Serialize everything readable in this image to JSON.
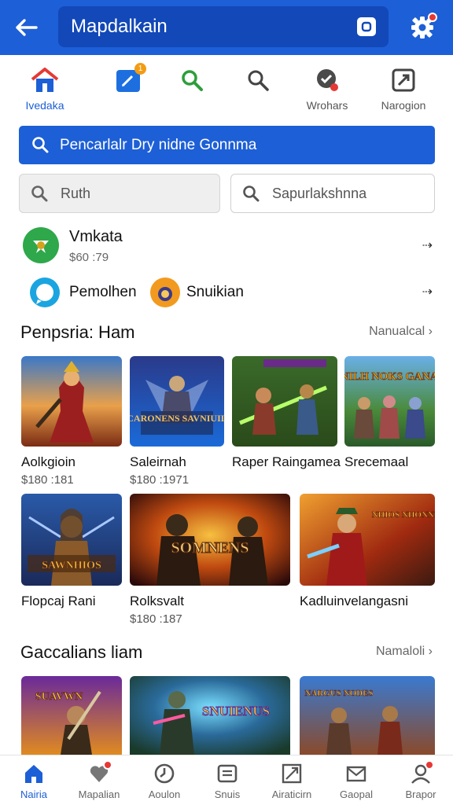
{
  "appbar": {
    "title": "Mapdalkain"
  },
  "categories": [
    {
      "label": "Ivedaka",
      "icon": "home-icon",
      "active": true
    },
    {
      "label": "",
      "icon": "edit-icon",
      "badge": "1"
    },
    {
      "label": "",
      "icon": "search-green-icon"
    },
    {
      "label": "",
      "icon": "search-icon"
    },
    {
      "label": "Wrohars",
      "icon": "award-icon"
    },
    {
      "label": "Narogion",
      "icon": "navigation-icon"
    }
  ],
  "search": {
    "main_placeholder": "Pencarlalr Dry nidne Gonnma",
    "left_placeholder": "Ruth",
    "right_placeholder": "Sapurlakshnna"
  },
  "list": [
    {
      "title": "Vmkata",
      "subtitle": "$60 :79",
      "icon": "green-badge-icon"
    },
    {
      "title": "Pemolhen",
      "icon": "chat-bubble-icon"
    },
    {
      "title": "Snuikian",
      "icon": "orange-avatar-icon"
    }
  ],
  "section1": {
    "title": "Penpsria: Ham",
    "link": "Nanualcal"
  },
  "row1": [
    {
      "name": "Aolkgioin",
      "price": "$180 :181",
      "caption": ""
    },
    {
      "name": "Saleirnah",
      "price": "$180 :1971",
      "caption": "CARONENS SAVNIUIL"
    },
    {
      "name": "Raper Raingamea",
      "price": "",
      "caption": ""
    },
    {
      "name": "Srecemaal",
      "price": "",
      "caption": "SNILH NOKS GANAS"
    }
  ],
  "row2": [
    {
      "name": "Flopcaj Rani",
      "price": "",
      "caption": "SAWNHIOS"
    },
    {
      "name": "Rolksvalt",
      "price": "$180 :187",
      "caption": "SOMNENS"
    },
    {
      "name": "Kadluinvelangasni",
      "price": "",
      "caption": "NHIOS NHONNES"
    }
  ],
  "section2": {
    "title": "Gaccalians liam",
    "link": "Namaloli"
  },
  "row3": [
    {
      "caption": "SUAVWN"
    },
    {
      "caption": "SNUIENUS"
    },
    {
      "caption": "NARGUS NODES"
    }
  ],
  "bottom_nav": [
    {
      "label": "Nairia",
      "icon": "home-icon",
      "active": true
    },
    {
      "label": "Mapalian",
      "icon": "heart-icon",
      "badge": true
    },
    {
      "label": "Aoulon",
      "icon": "clock-icon"
    },
    {
      "label": "Snuis",
      "icon": "box-icon"
    },
    {
      "label": "Airaticirn",
      "icon": "frame-icon"
    },
    {
      "label": "Gaopal",
      "icon": "mail-icon"
    },
    {
      "label": "Brapor",
      "icon": "profile-icon",
      "badge": true
    }
  ],
  "colors": {
    "primary": "#1d5fd6",
    "primary_dark": "#1248b8",
    "badge": "#e53935"
  }
}
